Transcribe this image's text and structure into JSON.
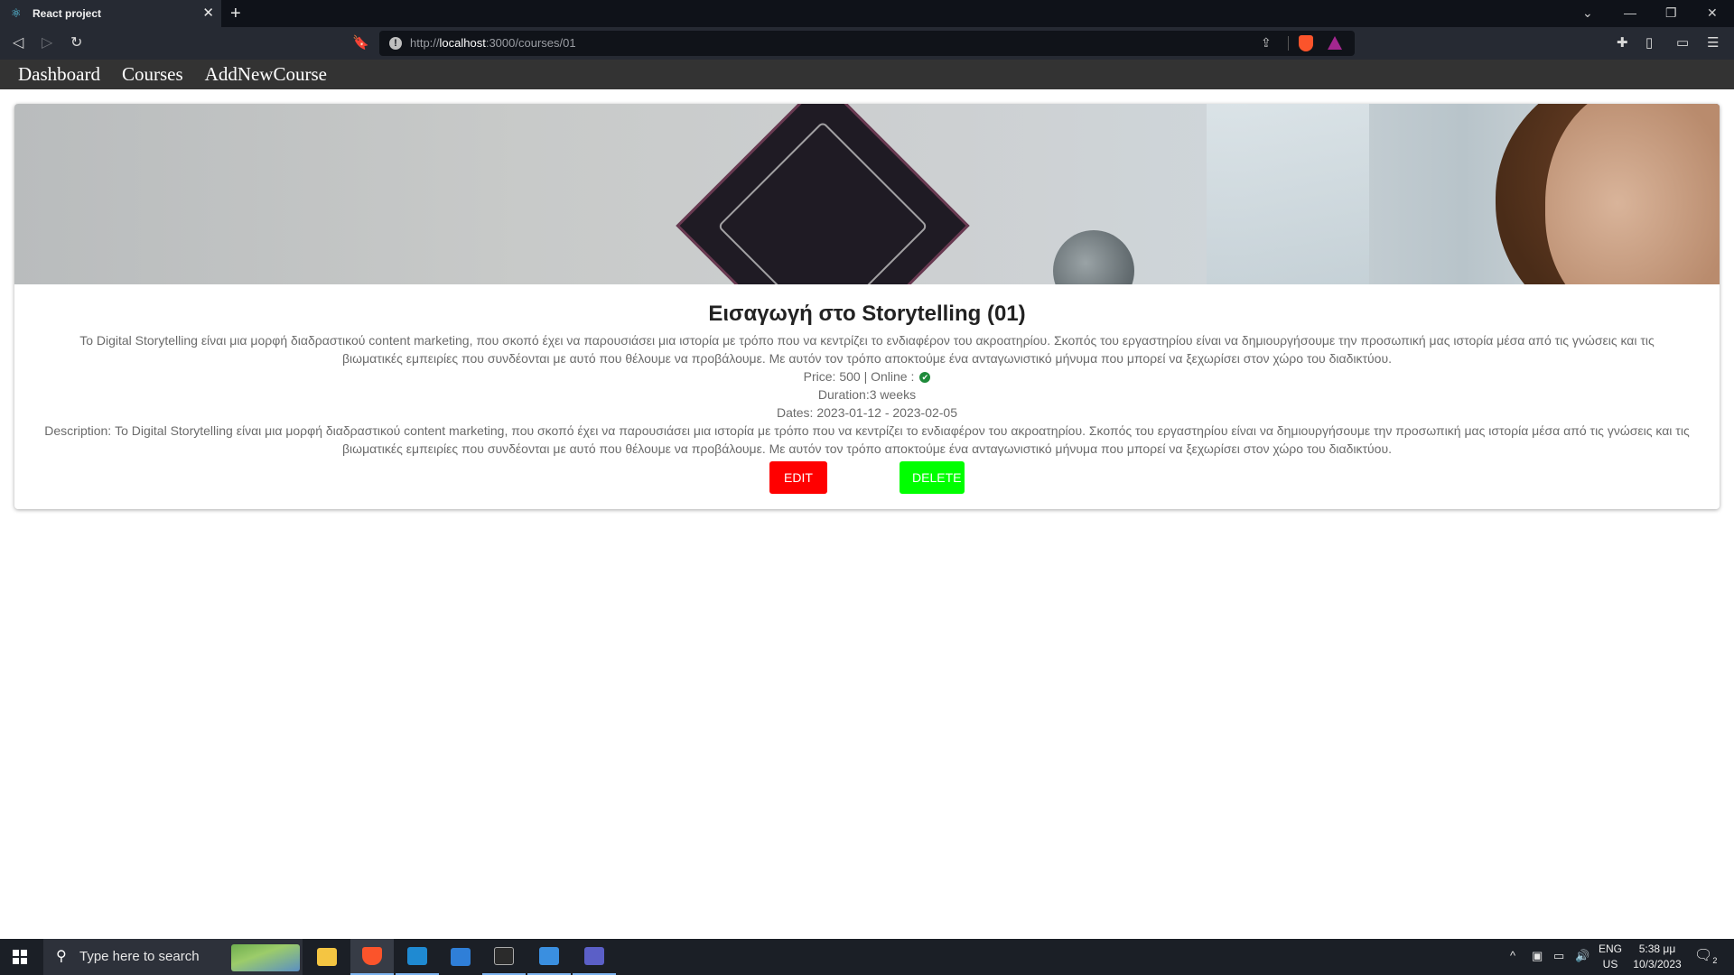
{
  "browser": {
    "tab_title": "React project",
    "url_prefix": "http://",
    "url_host": "localhost",
    "url_path": ":3000/courses/01"
  },
  "app_nav": {
    "links": [
      "Dashboard",
      "Courses",
      "AddNewCourse"
    ]
  },
  "course": {
    "title": "Εισαγωγή στο Storytelling (01)",
    "summary": "Το Digital Storytelling είναι μια μορφή διαδραστικού content marketing, που σκοπό έχει να παρουσιάσει μια ιστορία με τρόπο που να κεντρίζει το ενδιαφέρον του ακροατηρίου. Σκοπός του εργαστηρίου είναι να δημιουργήσουμε την προσωπική μας ιστορία μέσα από τις γνώσεις και τις βιωματικές εμπειρίες που συνδέονται με αυτό που θέλουμε να προβάλουμε. Με αυτόν τον τρόπο αποκτούμε ένα ανταγωνιστικό μήνυμα που μπορεί να ξεχωρίσει στον χώρο του διαδικτύου.",
    "price_line": "Price: 500 | Online :",
    "online": true,
    "duration_line": "Duration:3 weeks",
    "dates_line": "Dates: 2023-01-12 - 2023-02-05",
    "description_line": "Description: Το Digital Storytelling είναι μια μορφή διαδραστικού content marketing, που σκοπό έχει να παρουσιάσει μια ιστορία με τρόπο που να κεντρίζει το ενδιαφέρον του ακροατηρίου. Σκοπός του εργαστηρίου είναι να δημιουργήσουμε την προσωπική μας ιστορία μέσα από τις γνώσεις και τις βιωματικές εμπειρίες που συνδέονται με αυτό που θέλουμε να προβάλουμε. Με αυτόν τον τρόπο αποκτούμε ένα ανταγωνιστικό μήνυμα που μπορεί να ξεχωρίσει στον χώρο του διαδικτύου.",
    "edit_label": "EDIT",
    "delete_label": "DELETE",
    "edit_color": "#ff0000",
    "delete_color": "#00ff00"
  },
  "taskbar": {
    "search_placeholder": "Type here to search",
    "lang_line1": "ENG",
    "lang_line2": "US",
    "time": "5:38 μμ",
    "date": "10/3/2023",
    "notification_count": "2",
    "apps": [
      "file-explorer",
      "brave-browser",
      "vscode",
      "mail",
      "terminal",
      "photos",
      "teams"
    ]
  }
}
